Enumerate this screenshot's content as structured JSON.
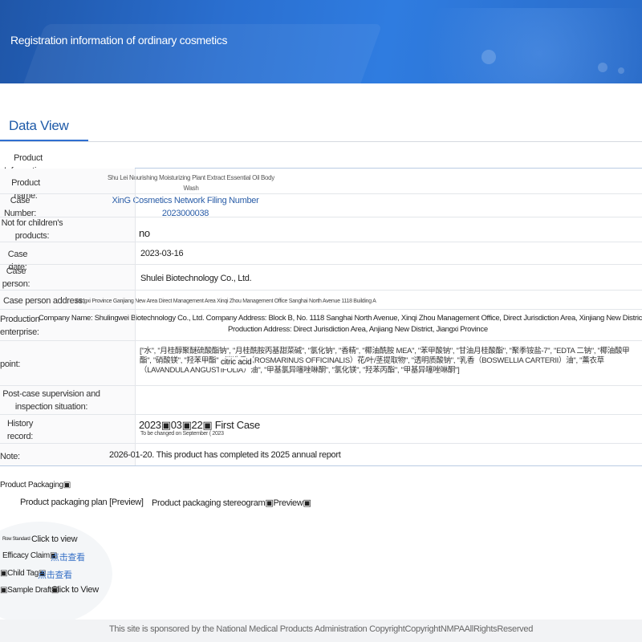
{
  "header": {
    "title": "Registration information of ordinary cosmetics"
  },
  "tabs": {
    "data_view": "Data View"
  },
  "product_info": {
    "section_label": "Product Information",
    "section_marker": "▣",
    "product_name_label": "Product name:",
    "product_name_value_line1": "Shu Lei Nourishing Moisturizing Plant Extract Essential Oil Body",
    "product_name_value_line2": "Wash",
    "case_number_label_line1": "Case",
    "case_number_label_line2": "Number:",
    "case_number_value_line1": "XinG Cosmetics Network Filing Number",
    "case_number_value_line2": "2023000038",
    "not_children_label_line1": "Not for children's",
    "not_children_label_line2": "products:",
    "not_children_value": "no",
    "case_date_label": "Case date:",
    "case_date_value": "2023-03-16",
    "case_person_label_line1": "Case",
    "case_person_label_line2": "person:",
    "case_person_value": "Shulei Biotechnology Co., Ltd.",
    "case_person_address_label": "Case person address:",
    "case_person_address_value": "Jiangxi Province Ganjiang New Area Direct Management Area Xinqi Zhou Management Office Sanghai North Avenue 1118 Building A",
    "production_label_line1": "Production",
    "production_label_line2": "enterprise:",
    "production_value_line1": "Company Name: Shulingwei Biotechnology Co., Ltd. Company Address: Block B, No. 1118 Sanghai North Avenue, Xinqi Zhou Management Office, Direct Jurisdiction Area, Xinjiang New District, Jiangxi Province",
    "production_value_line2": "Production Address: Direct Jurisdiction Area, Anjiang New District, Jiangxi Province",
    "point_label": "point:",
    "point_value": "[\"水\", \"月桂醇聚醚硫酸酯钠\", \"月桂酰胺丙基甜菜碱\", \"氯化钠\", \"香精\", \"椰油酰胺 MEA\", \"苯甲酸钠\", \"甘油月桂酸酯\", \"聚季铵盐-7\", \"EDTA 二钠\", \"椰油酸甲酯\", \"硝酸镁\", \"羟苯甲酯\", \"迷迭香（ROSMARINUS OFFICINALIS）花/叶/茎提取物\", \"透明质酸钠\", \"乳香（BOSWELLIA CARTERII）油\", \"薰衣草（LAVANDULA ANGUSTIFOLIA）油\", \"甲基氯异噻唑啉酮\", \"氯化镁\", \"羟苯丙酯\", \"甲基异噻唑啉酮\"]",
    "point_overlay": "citric acid",
    "supervision_label_line1": "Post-case supervision and",
    "supervision_label_line2": "inspection situation:",
    "history_label_line1": "History",
    "history_label_line2": "record:",
    "history_value": "2023▣03▣22▣ First Case",
    "history_sub": "To be changed on September ( 2023",
    "note_label": "Note:",
    "note_value": "2026-01-20. This product has completed its 2025 annual report"
  },
  "packaging": {
    "title": "Product Packaging▣",
    "plan_link": "Product packaging plan [Preview]",
    "stereogram_link": "Product packaging stereogram▣Preview▣"
  },
  "bottom_items": {
    "row_standard_label": "Row Standard",
    "row_standard_link": "Click to view",
    "efficacy_label": "Efficacy Claim▣",
    "efficacy_link": "点击查看",
    "child_tag_label": "▣Child Tag▣",
    "child_tag_link": "点击查看",
    "sample_label": "▣Sample Draft▣",
    "sample_link": "Click to View"
  },
  "footer": {
    "text": "This site is sponsored by the National Medical Products Administration CopyrightCopyrightNMPAAllRightsReserved"
  },
  "colors": {
    "banner": "#2a6fd0",
    "link_blue": "#2b5ea8",
    "tab_blue": "#1e5aa8"
  }
}
